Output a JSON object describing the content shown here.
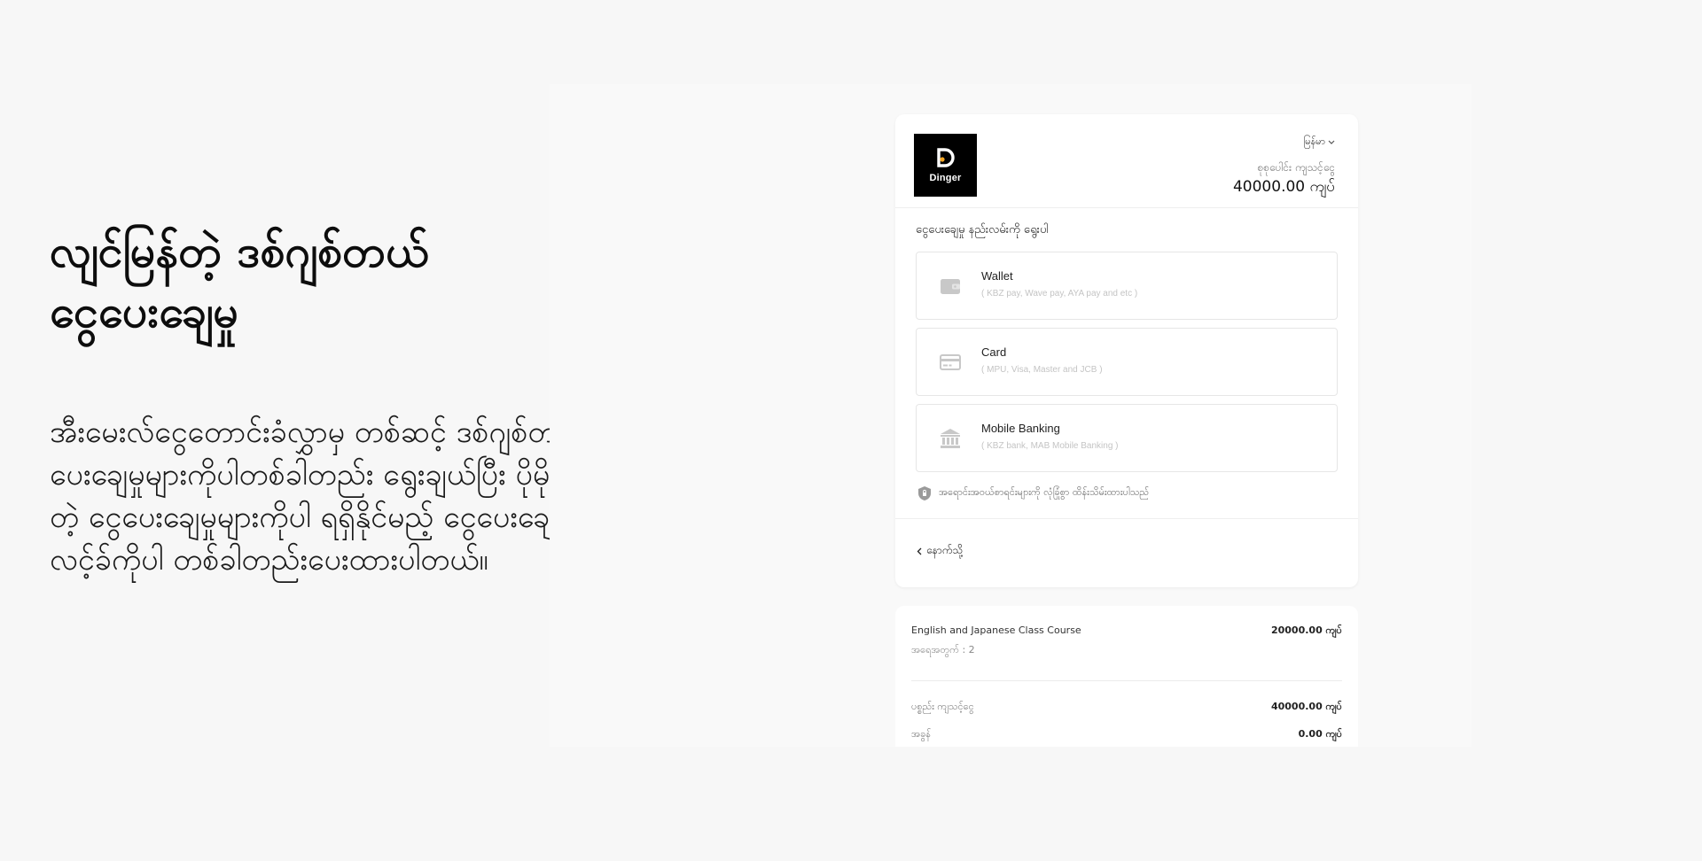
{
  "hero": {
    "title_line1": "လျင်မြန်တဲ့ ဒစ်ဂျစ်တယ်",
    "title_line2": "ငွေပေးချေမှု",
    "description": "အီးမေးလ်ငွေတောင်းခံလွှာမှ တစ်ဆင့် ဒစ်ဂျစ်တယ် ငွေပေးချေမှုများကိုပါတစ်ခါတည်း ရွေးချယ်ပြီး ပိုမိုမြန်ဆန်တဲ့ ငွေပေးချေမှုများကိုပါ ရရှိနိုင်မည့် ငွေပေးချေနိုင်တဲ့ လင့်ခ်ကိုပါ တစ်ခါတည်းပေးထားပါတယ်။"
  },
  "payment": {
    "logo_text": "Dinger",
    "language": "မြန်မာ",
    "total_label": "စုစုပေါင်း ကျသင့်ငွေ",
    "total_amount": "40000.00 ကျပ်",
    "choose_label": "ငွေပေးချေမှု နည်းလမ်းကို ရွေးပါ",
    "methods": [
      {
        "name": "Wallet",
        "sub": "( KBZ pay, Wave pay, AYA pay and etc )",
        "icon": "wallet-icon"
      },
      {
        "name": "Card",
        "sub": "( MPU, Visa, Master and JCB )",
        "icon": "credit-card-icon"
      },
      {
        "name": "Mobile Banking",
        "sub": "( KBZ bank, MAB Mobile Banking )",
        "icon": "bank-icon"
      }
    ],
    "secure_note": "အရောင်းအဝယ်စာရင်းများကို လုံခြုံစွာ ထိန်းသိမ်းထားပါသည်",
    "back_label": "နောက်သို့"
  },
  "order": {
    "item_name": "English and Japanese Class Course",
    "item_price": "20000.00 ကျပ်",
    "quantity": "အရေအတွက် : 2",
    "subtotal_label": "ပစ္စည်း ကျသင့်ငွေ",
    "subtotal_value": "40000.00 ကျပ်",
    "tax_label": "အခွန်",
    "tax_value": "0.00 ကျပ်"
  },
  "colors": {
    "page_bg": "#f7f7f7",
    "card_bg": "#ffffff",
    "logo_bg": "#000000",
    "accent_dot": "#f5a623",
    "icon_gray": "#c8c8c8"
  }
}
